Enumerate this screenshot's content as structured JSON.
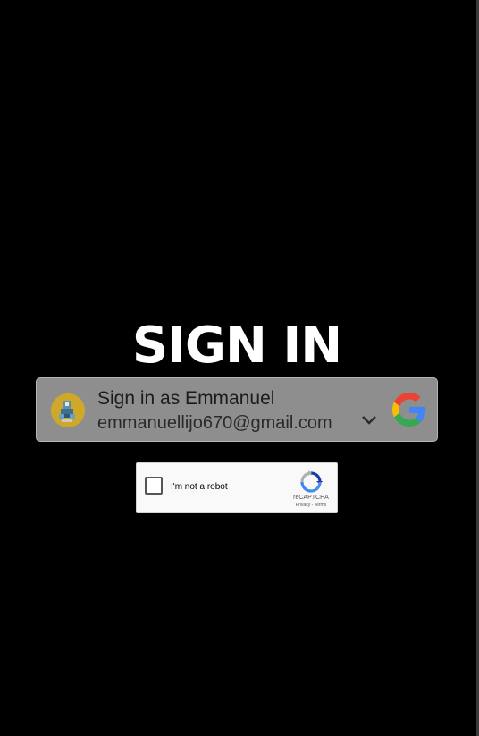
{
  "page": {
    "title": "SIGN IN",
    "background": "#000000"
  },
  "google_signin": {
    "name_line": "Sign in as Emmanuel",
    "email": "emmanuellijo670@gmail.com",
    "avatar_icon": "avatar-image",
    "dropdown_icon": "chevron-down-icon",
    "brand_icon": "google-logo-icon"
  },
  "recaptcha": {
    "label": "I'm not a robot",
    "brand": "reCAPTCHA",
    "privacy_link": "Privacy",
    "separator": " - ",
    "terms_link": "Terms"
  }
}
